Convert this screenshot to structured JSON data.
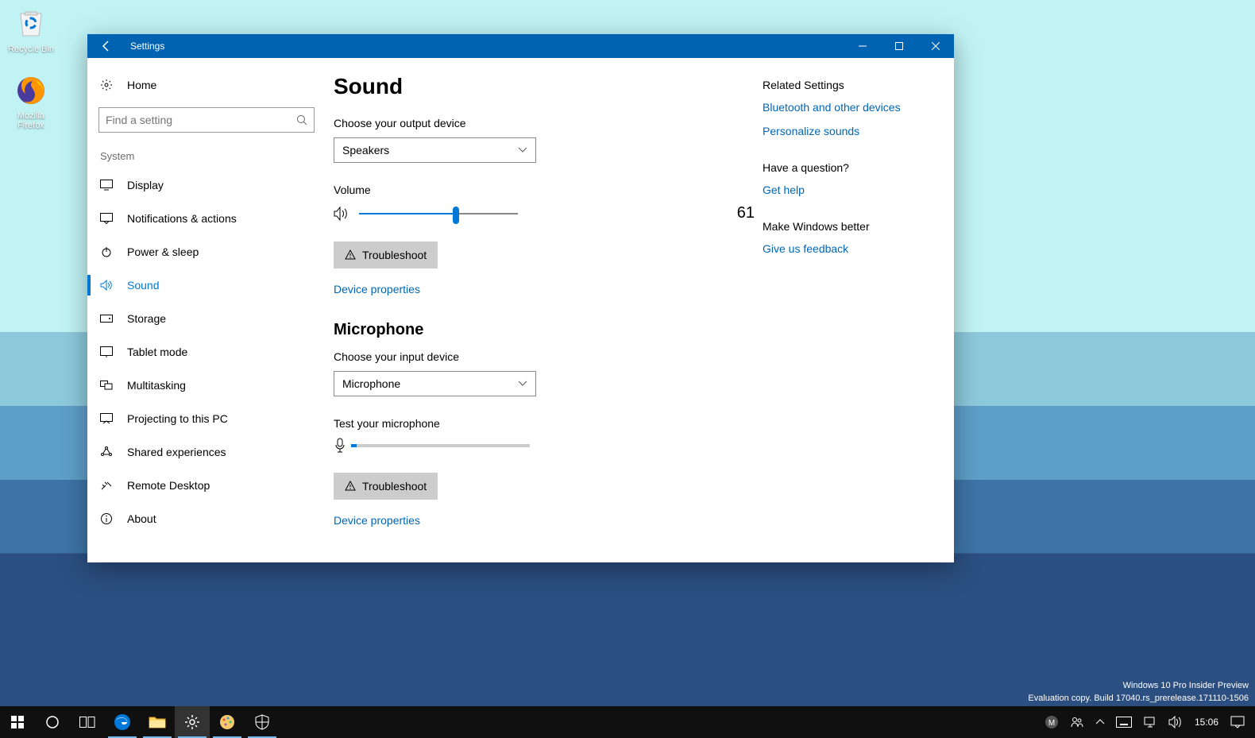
{
  "desktop": {
    "icons": [
      {
        "label": "Recycle Bin"
      },
      {
        "label": "Mozilla Firefox"
      }
    ]
  },
  "watermark": {
    "line1": "Windows 10 Pro Insider Preview",
    "line2": "Evaluation copy. Build 17040.rs_prerelease.171110-1506"
  },
  "taskbar": {
    "clock": "15:06"
  },
  "window": {
    "title": "Settings",
    "sidebar": {
      "home": "Home",
      "search_placeholder": "Find a setting",
      "category": "System",
      "items": [
        {
          "label": "Display"
        },
        {
          "label": "Notifications & actions"
        },
        {
          "label": "Power & sleep"
        },
        {
          "label": "Sound"
        },
        {
          "label": "Storage"
        },
        {
          "label": "Tablet mode"
        },
        {
          "label": "Multitasking"
        },
        {
          "label": "Projecting to this PC"
        },
        {
          "label": "Shared experiences"
        },
        {
          "label": "Remote Desktop"
        },
        {
          "label": "About"
        }
      ]
    },
    "main": {
      "heading": "Sound",
      "output_label": "Choose your output device",
      "output_value": "Speakers",
      "volume_label": "Volume",
      "volume_value": "61",
      "volume_percent": 61,
      "troubleshoot_label": "Troubleshoot",
      "device_props_label": "Device properties",
      "mic_heading": "Microphone",
      "input_label": "Choose your input device",
      "input_value": "Microphone",
      "test_mic_label": "Test your microphone",
      "mic_level_percent": 3,
      "troubleshoot2_label": "Troubleshoot",
      "device_props2_label": "Device properties"
    },
    "right": {
      "related_heading": "Related Settings",
      "related_links": [
        "Bluetooth and other devices",
        "Personalize sounds"
      ],
      "question_heading": "Have a question?",
      "help_link": "Get help",
      "better_heading": "Make Windows better",
      "feedback_link": "Give us feedback"
    }
  }
}
